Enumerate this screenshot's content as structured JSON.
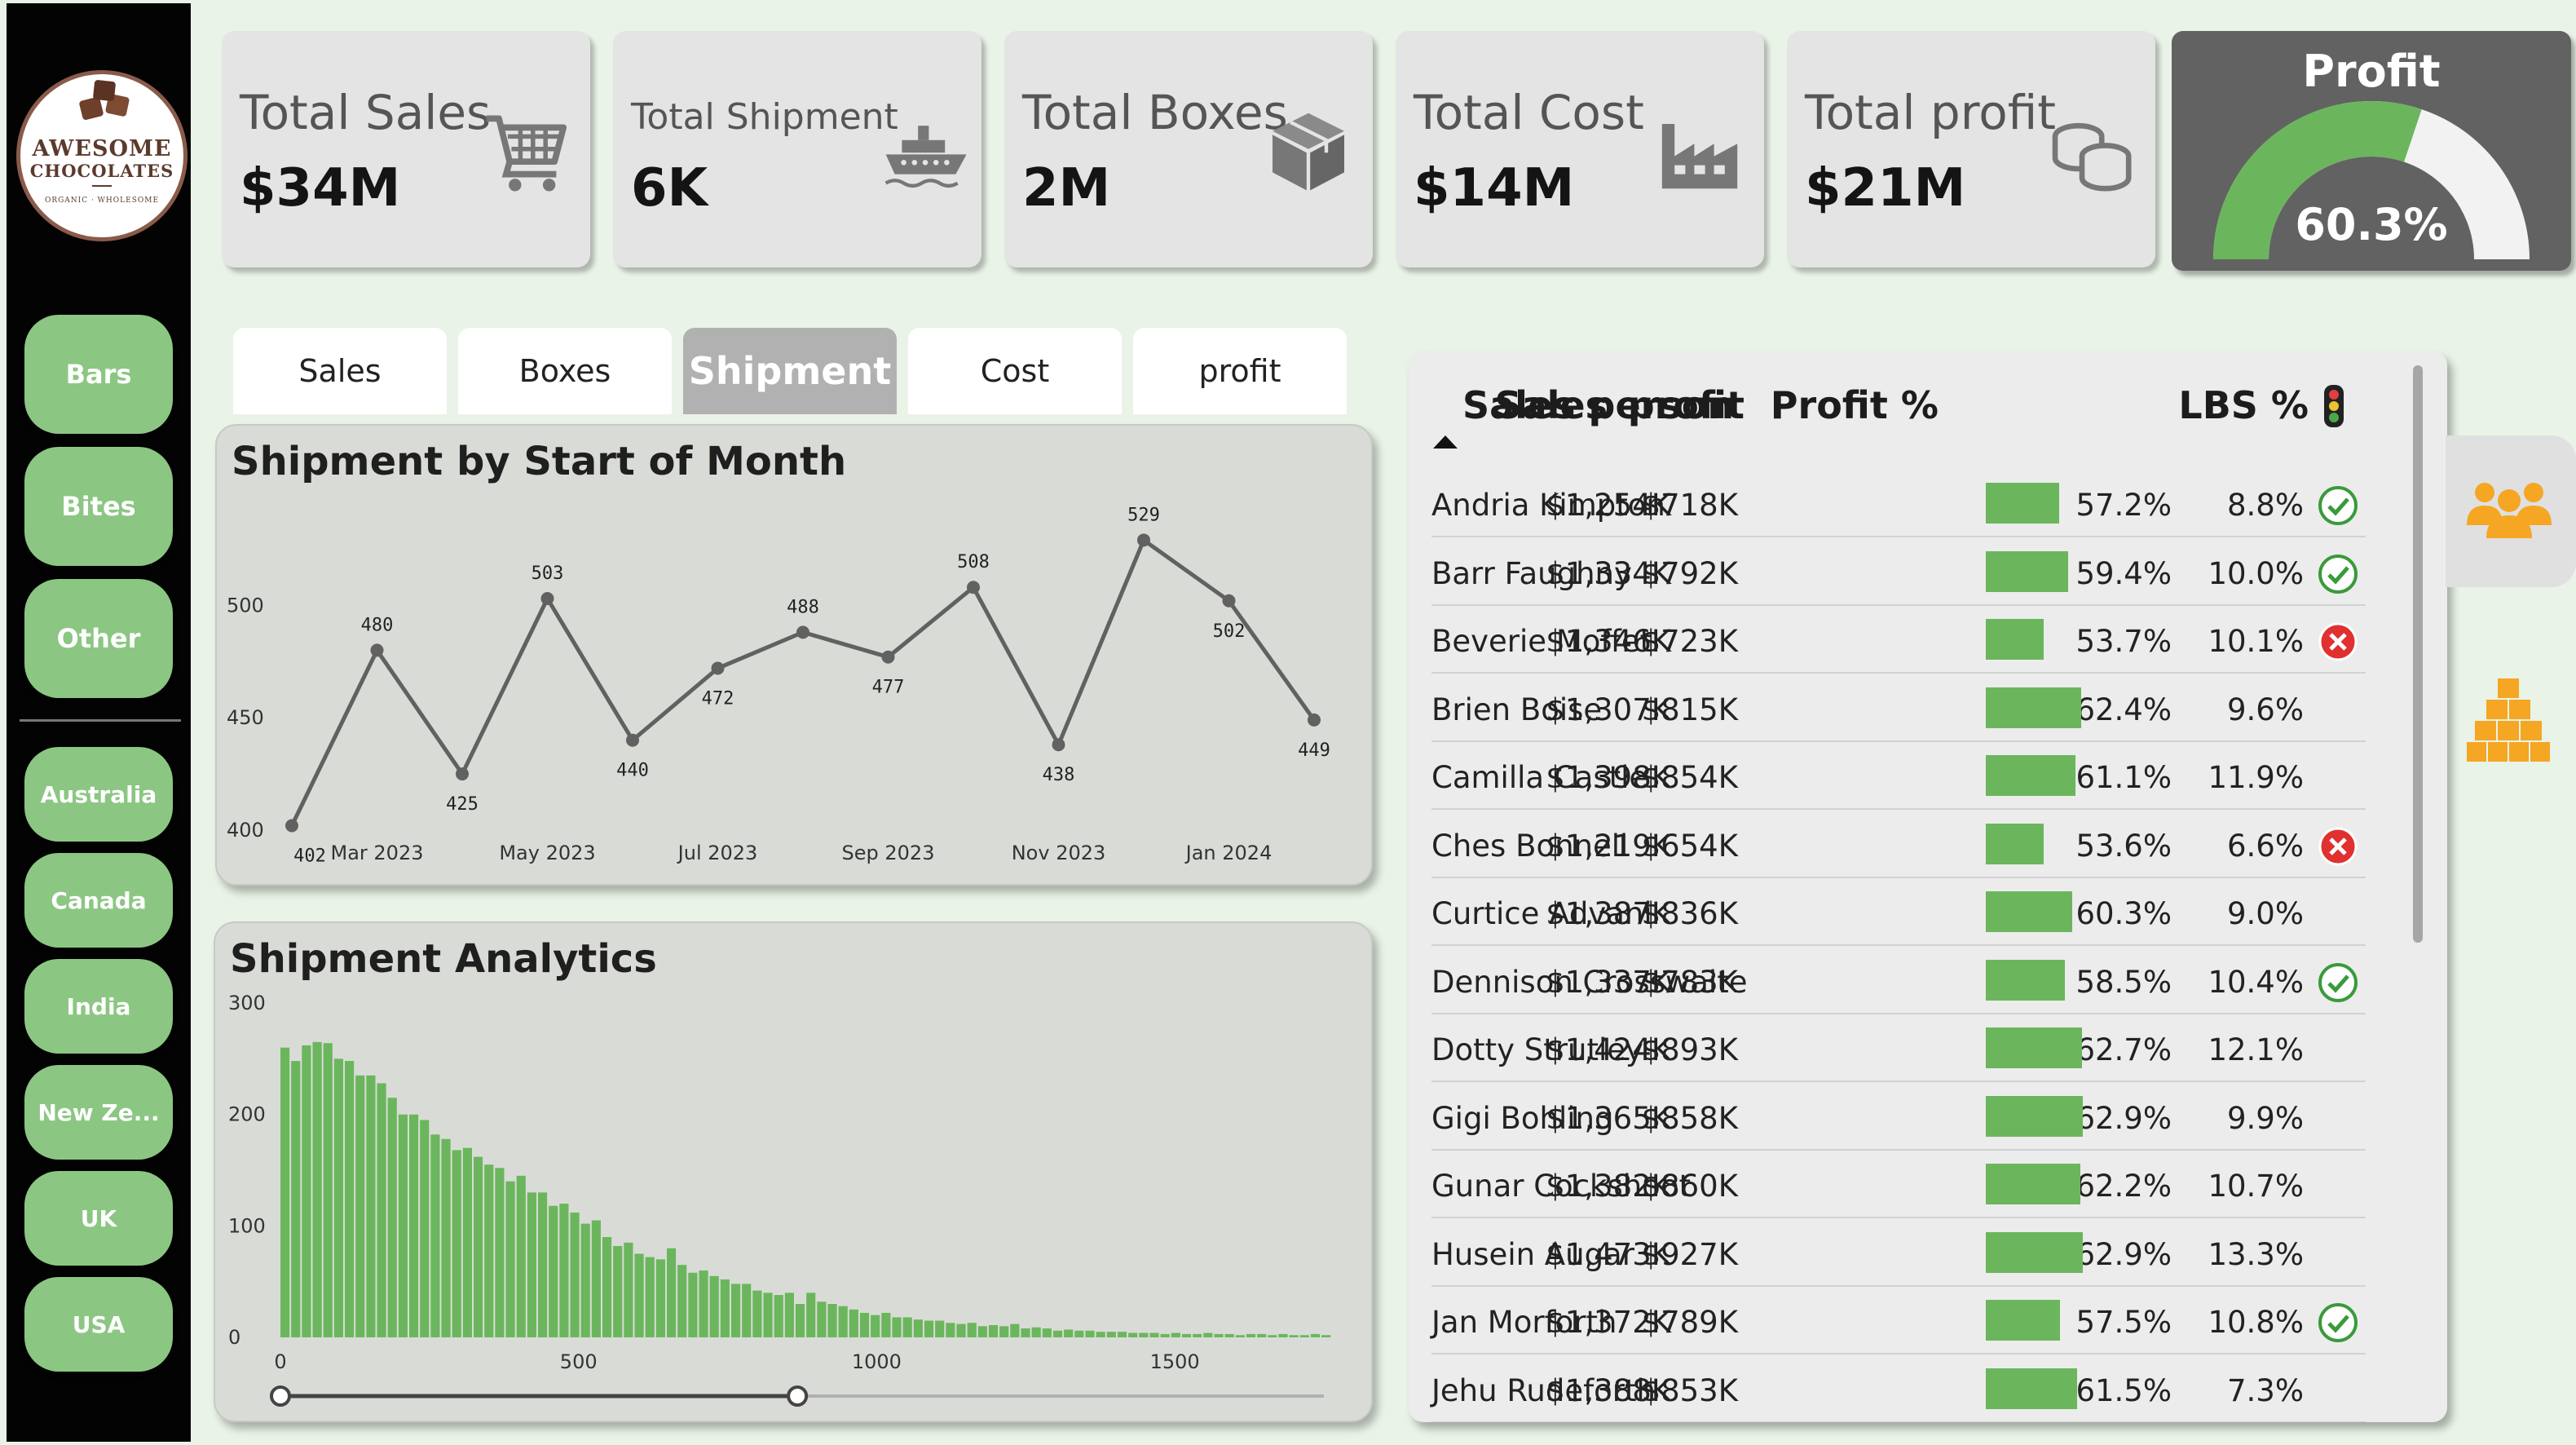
{
  "brand": {
    "line1": "AWESOME",
    "line2": "CHOCOLATES",
    "tagline": "ORGANIC · WHOLESOME"
  },
  "sidebar": {
    "products": [
      {
        "label": "Bars"
      },
      {
        "label": "Bites"
      },
      {
        "label": "Other"
      }
    ],
    "countries": [
      {
        "label": "Australia"
      },
      {
        "label": "Canada"
      },
      {
        "label": "India"
      },
      {
        "label": "New Ze..."
      },
      {
        "label": "UK"
      },
      {
        "label": "USA"
      }
    ]
  },
  "kpis": [
    {
      "label": "Total Sales",
      "value": "$34M",
      "icon": "cart-icon"
    },
    {
      "label": "Total Shipment",
      "value": "6K",
      "icon": "ship-icon"
    },
    {
      "label": "Total Boxes",
      "value": "2M",
      "icon": "box-icon"
    },
    {
      "label": "Total Cost",
      "value": "$14M",
      "icon": "factory-icon"
    },
    {
      "label": "Total profit",
      "value": "$21M",
      "icon": "coins-icon"
    }
  ],
  "profit_gauge": {
    "title": "Profit",
    "value_label": "60.3%",
    "value": 60.3,
    "fill_color": "#6bb65d",
    "track_color": "#f2f2f2"
  },
  "tabs": [
    {
      "label": "Sales"
    },
    {
      "label": "Boxes"
    },
    {
      "label": "Shipment"
    },
    {
      "label": "Cost"
    },
    {
      "label": "profit"
    }
  ],
  "active_tab": "Shipment",
  "line_panel": {
    "title": "Shipment by Start of Month"
  },
  "hist_panel": {
    "title": "Shipment Analytics"
  },
  "chart_data": [
    {
      "type": "line",
      "title": "Shipment by Start of Month",
      "x": [
        "Feb 2023",
        "Mar 2023",
        "Apr 2023",
        "May 2023",
        "Jun 2023",
        "Jul 2023",
        "Aug 2023",
        "Sep 2023",
        "Oct 2023",
        "Nov 2023",
        "Dec 2023",
        "Jan 2024",
        "Feb 2024"
      ],
      "x_tick_labels": [
        "Mar 2023",
        "May 2023",
        "Jul 2023",
        "Sep 2023",
        "Nov 2023",
        "Jan 2024"
      ],
      "values": [
        402,
        480,
        425,
        503,
        440,
        472,
        488,
        477,
        508,
        438,
        529,
        502,
        449
      ],
      "yticks": [
        400,
        450,
        500
      ],
      "ylim": [
        400,
        540
      ],
      "color": "#616161"
    },
    {
      "type": "bar",
      "title": "Shipment Analytics",
      "bin_width": 18,
      "x_start": 0,
      "values": [
        260,
        248,
        262,
        265,
        264,
        250,
        248,
        235,
        235,
        228,
        215,
        200,
        200,
        195,
        182,
        178,
        168,
        170,
        162,
        155,
        152,
        140,
        145,
        130,
        130,
        118,
        120,
        112,
        102,
        105,
        90,
        82,
        85,
        75,
        72,
        70,
        80,
        65,
        58,
        60,
        55,
        52,
        48,
        48,
        42,
        40,
        38,
        40,
        30,
        40,
        32,
        30,
        28,
        25,
        22,
        20,
        22,
        18,
        18,
        16,
        15,
        15,
        13,
        12,
        13,
        10,
        11,
        10,
        12,
        8,
        9,
        8,
        6,
        7,
        6,
        6,
        5,
        5,
        5,
        4,
        4,
        4,
        3,
        4,
        3,
        3,
        4,
        3,
        3,
        2,
        3,
        3,
        2,
        3,
        2,
        2,
        3,
        2,
        3,
        2,
        2,
        3,
        2,
        2,
        2,
        2,
        3,
        2,
        2,
        2,
        2,
        3,
        4,
        2,
        5,
        2,
        2,
        2,
        2,
        2,
        2,
        2,
        2,
        2,
        2,
        4,
        6,
        2,
        2,
        2,
        2,
        2,
        2,
        6,
        2,
        2,
        2,
        2,
        2,
        2,
        4,
        2,
        2,
        2,
        2,
        2,
        2,
        2,
        2,
        2,
        2,
        2,
        2,
        5,
        2,
        2,
        2,
        2,
        2,
        2,
        2,
        5,
        2,
        2,
        2,
        2,
        2,
        2,
        2,
        2,
        2,
        2,
        2,
        2,
        2,
        2,
        2,
        2,
        2,
        4,
        2,
        2,
        2,
        2,
        2,
        2,
        2,
        2,
        2,
        2,
        2,
        2,
        2,
        2,
        2,
        2,
        2,
        2,
        2,
        2,
        2,
        2,
        2,
        2,
        2,
        2,
        2,
        2,
        2,
        2,
        2,
        2,
        2,
        2,
        2,
        2,
        2,
        2,
        2,
        2,
        2,
        2,
        2,
        2,
        2,
        2,
        2,
        2,
        2,
        2,
        2,
        2,
        2,
        2,
        2,
        2,
        2,
        2,
        2,
        2,
        2,
        2,
        2,
        2,
        2,
        2,
        2,
        2,
        2,
        2,
        2,
        2,
        2,
        2,
        2,
        2,
        2,
        2,
        2,
        2,
        2,
        2,
        2,
        2,
        2,
        2,
        2,
        2,
        2,
        2,
        2,
        2,
        2,
        2,
        2,
        2,
        2,
        2,
        2,
        2,
        2,
        2,
        2,
        2,
        2,
        2,
        2,
        2,
        2,
        2,
        2,
        2,
        2,
        2,
        2,
        2,
        2,
        2,
        2,
        2,
        2,
        2,
        2,
        2,
        2,
        2,
        2,
        2,
        2,
        2,
        2,
        2,
        2,
        2,
        2,
        2,
        2,
        2,
        2,
        2,
        2,
        2,
        2,
        2,
        2,
        2,
        2,
        2,
        2,
        2,
        2,
        2,
        2,
        2,
        2,
        2,
        2,
        2,
        2,
        2,
        2,
        2,
        2,
        2,
        2,
        2,
        2,
        2,
        2,
        2,
        2,
        2,
        2,
        2,
        2,
        2,
        2,
        2,
        2,
        2,
        2,
        2,
        2,
        2,
        2,
        2,
        2,
        2,
        2,
        2,
        2,
        2,
        2,
        2,
        2,
        2
      ],
      "xticks": [
        0,
        500,
        1000,
        1500
      ],
      "yticks": [
        0,
        100,
        200,
        300
      ],
      "xlim": [
        0,
        1750
      ],
      "ylim": [
        0,
        300
      ],
      "color": "#6bb65d",
      "range_slider": [
        0,
        867
      ]
    }
  ],
  "table": {
    "headers": {
      "name": "Sales person",
      "sales": "Sales",
      "profit": "profit",
      "profit_pct": "Profit %",
      "lbs_pct": "LBS %"
    },
    "rows": [
      {
        "name": "Andria Kimpton",
        "sales": "$1,254K",
        "profit": "$718K",
        "profit_pct": "57.2%",
        "pct": 57.2,
        "lbs": "8.8%",
        "status": "check"
      },
      {
        "name": "Barr Faughny",
        "sales": "$1,334K",
        "profit": "$792K",
        "profit_pct": "59.4%",
        "pct": 59.4,
        "lbs": "10.0%",
        "status": "check"
      },
      {
        "name": "Beverie Moffet",
        "sales": "$1,346K",
        "profit": "$723K",
        "profit_pct": "53.7%",
        "pct": 53.7,
        "lbs": "10.1%",
        "status": "cross"
      },
      {
        "name": "Brien Boise",
        "sales": "$1,307K",
        "profit": "$815K",
        "profit_pct": "62.4%",
        "pct": 62.4,
        "lbs": "9.6%",
        "status": ""
      },
      {
        "name": "Camilla Castle",
        "sales": "$1,398K",
        "profit": "$854K",
        "profit_pct": "61.1%",
        "pct": 61.1,
        "lbs": "11.9%",
        "status": ""
      },
      {
        "name": "Ches Bonnell",
        "sales": "$1,219K",
        "profit": "$654K",
        "profit_pct": "53.6%",
        "pct": 53.6,
        "lbs": "6.6%",
        "status": "cross"
      },
      {
        "name": "Curtice Advani",
        "sales": "$1,387K",
        "profit": "$836K",
        "profit_pct": "60.3%",
        "pct": 60.3,
        "lbs": "9.0%",
        "status": ""
      },
      {
        "name": "Dennison Crosswaite",
        "sales": "$1,337K",
        "profit": "$783K",
        "profit_pct": "58.5%",
        "pct": 58.5,
        "lbs": "10.4%",
        "status": "check"
      },
      {
        "name": "Dotty Strutley",
        "sales": "$1,424K",
        "profit": "$893K",
        "profit_pct": "62.7%",
        "pct": 62.7,
        "lbs": "12.1%",
        "status": ""
      },
      {
        "name": "Gigi Bohling",
        "sales": "$1,365K",
        "profit": "$858K",
        "profit_pct": "62.9%",
        "pct": 62.9,
        "lbs": "9.9%",
        "status": ""
      },
      {
        "name": "Gunar Cockshoot",
        "sales": "$1,382K",
        "profit": "$860K",
        "profit_pct": "62.2%",
        "pct": 62.2,
        "lbs": "10.7%",
        "status": ""
      },
      {
        "name": "Husein Augar",
        "sales": "$1,473K",
        "profit": "$927K",
        "profit_pct": "62.9%",
        "pct": 62.9,
        "lbs": "13.3%",
        "status": ""
      },
      {
        "name": "Jan Morforth",
        "sales": "$1,372K",
        "profit": "$789K",
        "profit_pct": "57.5%",
        "pct": 57.5,
        "lbs": "10.8%",
        "status": "check"
      },
      {
        "name": "Jehu Rudeforth",
        "sales": "$1,388K",
        "profit": "$853K",
        "profit_pct": "61.5%",
        "pct": 61.5,
        "lbs": "7.3%",
        "status": ""
      }
    ]
  },
  "side_icons": [
    "team-icon",
    "boxes-stack-icon"
  ],
  "colors": {
    "accent_green": "#6bb65d",
    "nav_green": "#8cc683",
    "icon_orange": "#f5a623",
    "check_green": "#3a9a3a",
    "cross_red": "#e03030"
  }
}
